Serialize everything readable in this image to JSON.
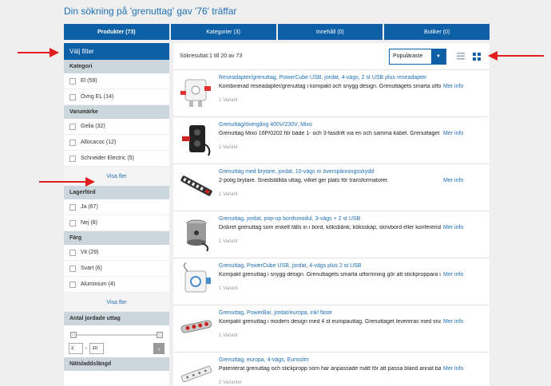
{
  "heading": "Din sökning på 'grenuttag' gav '76' träffar",
  "tabs": [
    "Produkter (73)",
    "Kategorier (3)",
    "Innehåll (0)",
    "Butiker (0)"
  ],
  "sidebar": {
    "title": "Välj filter",
    "kategori_title": "Kategori",
    "kategori": [
      {
        "label": "El (59)"
      },
      {
        "label": "Övrig EL (14)"
      }
    ],
    "varumarke_title": "Varumärke",
    "varumarke": [
      {
        "label": "Gelia (32)"
      },
      {
        "label": "Allocacoc (12)"
      },
      {
        "label": "Schneider Electric (5)"
      }
    ],
    "show_more_1": "Visa fler",
    "lagerford_title": "Lagerförd",
    "lagerford": [
      {
        "label": "Ja (67)"
      },
      {
        "label": "Nej (8)"
      }
    ],
    "farg_title": "Färg",
    "farg": [
      {
        "label": "Vit (29)"
      },
      {
        "label": "Svart (6)"
      },
      {
        "label": "Aluminium (4)"
      }
    ],
    "show_more_2": "Visa fler",
    "uttag_title": "Antal jordade uttag",
    "range_min": "2",
    "range_sep": "-",
    "range_max": "10",
    "go_label": "›",
    "natsladd_title": "Nätsladdslängd"
  },
  "main": {
    "result_count": "Sökresultat:1 till 20 av 73",
    "sort_label": "Populäraste",
    "sort_arrow": "▼"
  },
  "products": [
    {
      "title": "Reseadapter/grenuttag, PowerCube USB, jordat, 4-vägs, 2 st USB plus reseadapter",
      "desc": "Kombinerad reseadapter/grenuttag i kompakt och snygg design. Grenuttagets smarta utform...",
      "variant": "1 Variant",
      "more": "Mer info",
      "icon": "powercube-travel-image"
    },
    {
      "title": "Grenuttag/övergång 400V/230V, Mixo",
      "desc": "Grenuttag Mixo 16P/0202 för både 1- och 3-fasdrift via en och samma kabel. Grenuttaget är...",
      "variant": "1 Variant",
      "more": "Mer info",
      "icon": "mixo-outlet-image"
    },
    {
      "title": "Grenuttag med brytare, jordat, 10-vägs m överspänningsskydd",
      "desc": "2-polig brytare. Snedställda uttag, vilket ger plats för transformatorer.",
      "variant": "1 Variant",
      "more": "Mer info",
      "icon": "power-strip-10-image"
    },
    {
      "title": "Grenuttag, jordat, pop-up bordsmodul, 3-vägs + 2 st USB",
      "desc": "Diskret grenuttag som enkelt fälls in i bord, köksbänk, köksskåp, skrivbord eller konferensbo...",
      "variant": "1 Variant",
      "more": "Mer info",
      "icon": "popup-module-image"
    },
    {
      "title": "Grenuttag, PowerCube USB, jordat, 4-vägs plus 2 st USB",
      "desc": "Kompakt grenuttag i snygg design. Grenuttagets smarta utformning gör att stickproppara i...",
      "variant": "1 Variant",
      "more": "Mer info",
      "icon": "powercube-image"
    },
    {
      "title": "Grenuttag, PowerBar, jordat/europa, inkl fäste",
      "desc": "Kompakt grenuttag i modern design med 4 st europauttag. Grenuttaget levereras med snap...",
      "variant": "1 Variant",
      "more": "Mer info",
      "icon": "powerbar-image"
    },
    {
      "title": "Grenuttag, europa, 4-vägs, Euroslim",
      "desc": "Patenterat grenuttag och stickpropp som har anpassade mått för att passa bland annat bak...",
      "variant": "2 Varianter",
      "more": "Mer info",
      "icon": "euroslim-image"
    }
  ]
}
